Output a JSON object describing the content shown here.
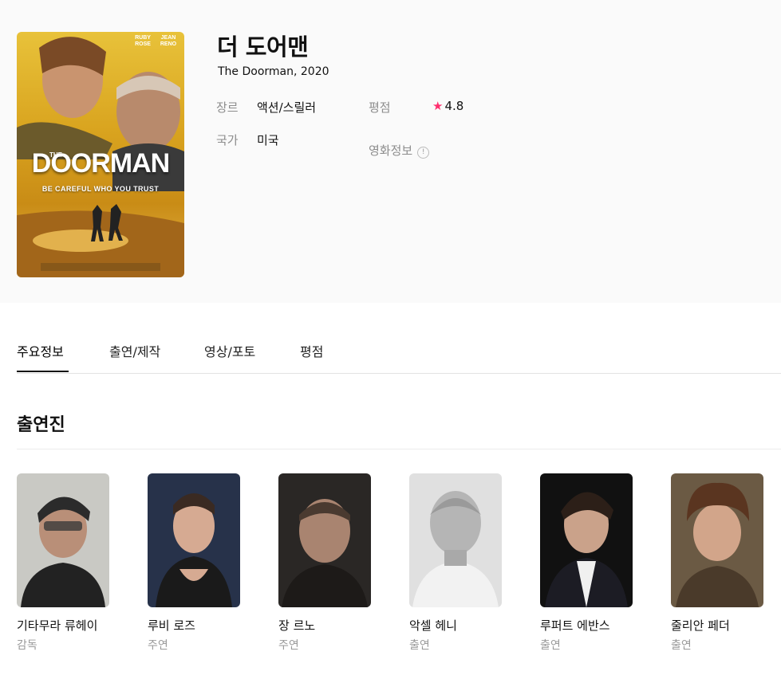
{
  "movie": {
    "title": "더 도어맨",
    "subtitle": "The Doorman, 2020",
    "genre_label": "장르",
    "genre": "액션/스릴러",
    "country_label": "국가",
    "country": "미국",
    "rating_label": "평점",
    "rating": "4.8",
    "info_label": "영화정보",
    "info_icon_glyph": "!",
    "poster": {
      "actor_top_1": "RUBY ROSE",
      "actor_top_2": "JEAN RENO",
      "the": "THE",
      "title": "DOORMAN",
      "tagline": "BE CAREFUL WHO YOU TRUST"
    }
  },
  "tabs": [
    {
      "label": "주요정보",
      "active": true
    },
    {
      "label": "출연/제작",
      "active": false
    },
    {
      "label": "영상/포토",
      "active": false
    },
    {
      "label": "평점",
      "active": false
    }
  ],
  "section": {
    "title": "출연진"
  },
  "cast": [
    {
      "name": "기타무라 류헤이",
      "role": "감독"
    },
    {
      "name": "루비 로즈",
      "role": "주연"
    },
    {
      "name": "장 르노",
      "role": "주연"
    },
    {
      "name": "악셀 헤니",
      "role": "출연"
    },
    {
      "name": "루퍼트 에반스",
      "role": "출연"
    },
    {
      "name": "줄리안 페더",
      "role": "출연"
    }
  ],
  "colors": {
    "rating_star": "#ff2f6e",
    "active_tab": "#111111",
    "muted_text": "#8c8c8c"
  },
  "icons": [
    "expand-icon",
    "star-icon",
    "info-icon"
  ]
}
